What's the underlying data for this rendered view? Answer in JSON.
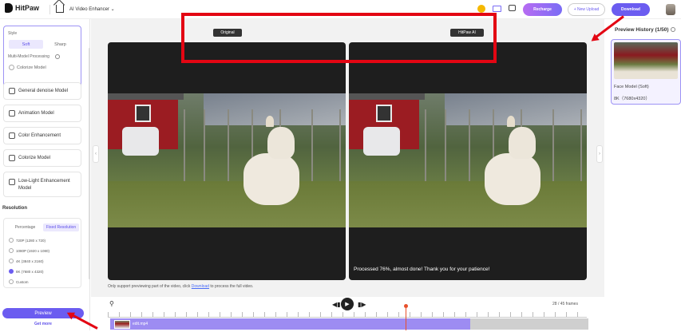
{
  "header": {
    "brand": "HitPaw",
    "app_name": "AI Video Enhancer ⌄",
    "recharge_label": "Recharge",
    "new_upload_label": "+ New Upload",
    "download_label": "Download"
  },
  "sidebar": {
    "style_label": "Style",
    "style_options": [
      "Soft",
      "Sharp"
    ],
    "multi_model_label": "Multi-Model Processing",
    "colorize_label": "Colorize Model",
    "models": [
      "General denoise Model",
      "Animation Model",
      "Color Enhancement",
      "Colorize Model",
      "Low-Light Enhancement Model"
    ],
    "resolution_title": "Resolution",
    "resolution_tabs": [
      "Percentage",
      "Fixed Resolution"
    ],
    "resolution_options": [
      "720P (1280 x 720)",
      "1080P (1920 x 1080)",
      "4K (3840 x 2160)",
      "8K (7680 x 4320)",
      "Custom"
    ],
    "preview_label": "Preview",
    "get_more_label": "Get more"
  },
  "preview": {
    "original_label": "Original",
    "ai_label": "HitPaw AI",
    "status_text": "Processed 76%, almost done! Thank you for your patience!",
    "note_prefix": "Only support previewing part of the video, click ",
    "note_link": "Download",
    "note_suffix": " to process the full video."
  },
  "timeline": {
    "frames": "28 / 45 frames",
    "clip_name": "edit.mp4"
  },
  "history": {
    "title": "Preview History (1/50)",
    "item_model": "Face Model (Soft)",
    "item_resolution": "8K（7680x4320）"
  },
  "colors": {
    "accent": "#6b5cf0",
    "annotation_red": "#e30613"
  }
}
